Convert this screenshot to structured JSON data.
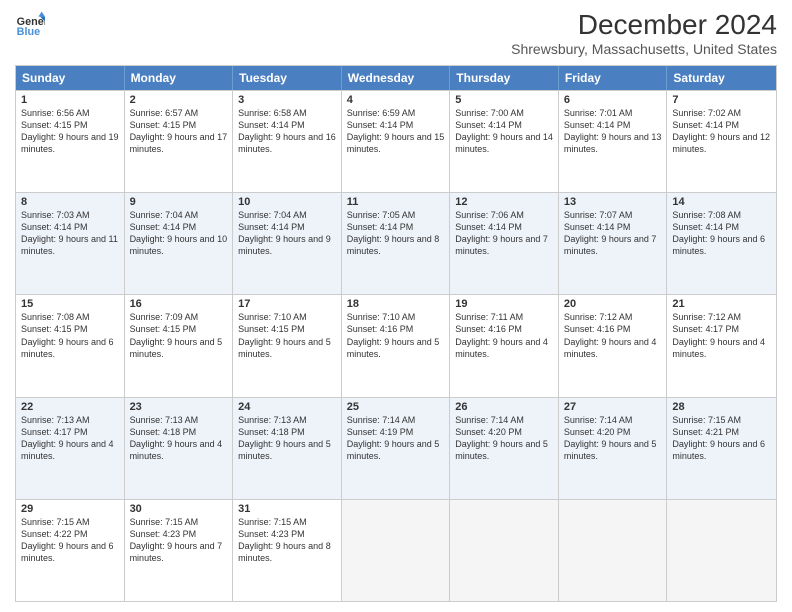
{
  "logo": {
    "line1": "General",
    "line2": "Blue"
  },
  "title": "December 2024",
  "subtitle": "Shrewsbury, Massachusetts, United States",
  "days": [
    "Sunday",
    "Monday",
    "Tuesday",
    "Wednesday",
    "Thursday",
    "Friday",
    "Saturday"
  ],
  "rows": [
    [
      {
        "num": "1",
        "sunrise": "6:56 AM",
        "sunset": "4:15 PM",
        "daylight": "9 hours and 19 minutes."
      },
      {
        "num": "2",
        "sunrise": "6:57 AM",
        "sunset": "4:15 PM",
        "daylight": "9 hours and 17 minutes."
      },
      {
        "num": "3",
        "sunrise": "6:58 AM",
        "sunset": "4:14 PM",
        "daylight": "9 hours and 16 minutes."
      },
      {
        "num": "4",
        "sunrise": "6:59 AM",
        "sunset": "4:14 PM",
        "daylight": "9 hours and 15 minutes."
      },
      {
        "num": "5",
        "sunrise": "7:00 AM",
        "sunset": "4:14 PM",
        "daylight": "9 hours and 14 minutes."
      },
      {
        "num": "6",
        "sunrise": "7:01 AM",
        "sunset": "4:14 PM",
        "daylight": "9 hours and 13 minutes."
      },
      {
        "num": "7",
        "sunrise": "7:02 AM",
        "sunset": "4:14 PM",
        "daylight": "9 hours and 12 minutes."
      }
    ],
    [
      {
        "num": "8",
        "sunrise": "7:03 AM",
        "sunset": "4:14 PM",
        "daylight": "9 hours and 11 minutes."
      },
      {
        "num": "9",
        "sunrise": "7:04 AM",
        "sunset": "4:14 PM",
        "daylight": "9 hours and 10 minutes."
      },
      {
        "num": "10",
        "sunrise": "7:04 AM",
        "sunset": "4:14 PM",
        "daylight": "9 hours and 9 minutes."
      },
      {
        "num": "11",
        "sunrise": "7:05 AM",
        "sunset": "4:14 PM",
        "daylight": "9 hours and 8 minutes."
      },
      {
        "num": "12",
        "sunrise": "7:06 AM",
        "sunset": "4:14 PM",
        "daylight": "9 hours and 7 minutes."
      },
      {
        "num": "13",
        "sunrise": "7:07 AM",
        "sunset": "4:14 PM",
        "daylight": "9 hours and 7 minutes."
      },
      {
        "num": "14",
        "sunrise": "7:08 AM",
        "sunset": "4:14 PM",
        "daylight": "9 hours and 6 minutes."
      }
    ],
    [
      {
        "num": "15",
        "sunrise": "7:08 AM",
        "sunset": "4:15 PM",
        "daylight": "9 hours and 6 minutes."
      },
      {
        "num": "16",
        "sunrise": "7:09 AM",
        "sunset": "4:15 PM",
        "daylight": "9 hours and 5 minutes."
      },
      {
        "num": "17",
        "sunrise": "7:10 AM",
        "sunset": "4:15 PM",
        "daylight": "9 hours and 5 minutes."
      },
      {
        "num": "18",
        "sunrise": "7:10 AM",
        "sunset": "4:16 PM",
        "daylight": "9 hours and 5 minutes."
      },
      {
        "num": "19",
        "sunrise": "7:11 AM",
        "sunset": "4:16 PM",
        "daylight": "9 hours and 4 minutes."
      },
      {
        "num": "20",
        "sunrise": "7:12 AM",
        "sunset": "4:16 PM",
        "daylight": "9 hours and 4 minutes."
      },
      {
        "num": "21",
        "sunrise": "7:12 AM",
        "sunset": "4:17 PM",
        "daylight": "9 hours and 4 minutes."
      }
    ],
    [
      {
        "num": "22",
        "sunrise": "7:13 AM",
        "sunset": "4:17 PM",
        "daylight": "9 hours and 4 minutes."
      },
      {
        "num": "23",
        "sunrise": "7:13 AM",
        "sunset": "4:18 PM",
        "daylight": "9 hours and 4 minutes."
      },
      {
        "num": "24",
        "sunrise": "7:13 AM",
        "sunset": "4:18 PM",
        "daylight": "9 hours and 5 minutes."
      },
      {
        "num": "25",
        "sunrise": "7:14 AM",
        "sunset": "4:19 PM",
        "daylight": "9 hours and 5 minutes."
      },
      {
        "num": "26",
        "sunrise": "7:14 AM",
        "sunset": "4:20 PM",
        "daylight": "9 hours and 5 minutes."
      },
      {
        "num": "27",
        "sunrise": "7:14 AM",
        "sunset": "4:20 PM",
        "daylight": "9 hours and 5 minutes."
      },
      {
        "num": "28",
        "sunrise": "7:15 AM",
        "sunset": "4:21 PM",
        "daylight": "9 hours and 6 minutes."
      }
    ],
    [
      {
        "num": "29",
        "sunrise": "7:15 AM",
        "sunset": "4:22 PM",
        "daylight": "9 hours and 6 minutes."
      },
      {
        "num": "30",
        "sunrise": "7:15 AM",
        "sunset": "4:23 PM",
        "daylight": "9 hours and 7 minutes."
      },
      {
        "num": "31",
        "sunrise": "7:15 AM",
        "sunset": "4:23 PM",
        "daylight": "9 hours and 8 minutes."
      },
      null,
      null,
      null,
      null
    ]
  ],
  "row_alt": [
    false,
    true,
    false,
    true,
    false
  ]
}
